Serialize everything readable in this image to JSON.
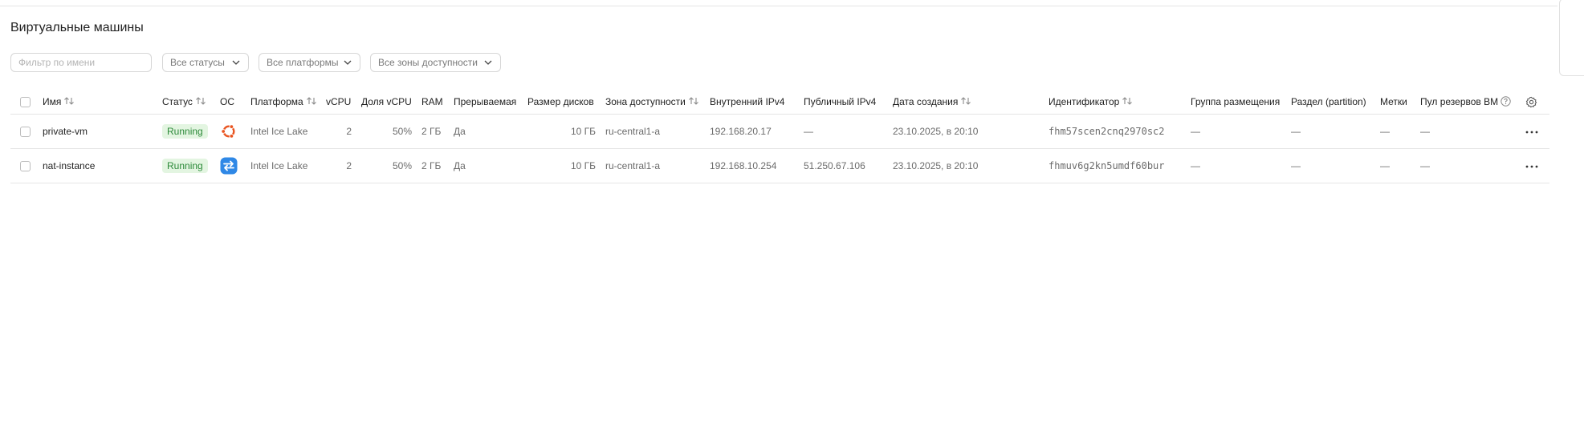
{
  "page": {
    "title": "Виртуальные машины"
  },
  "filters": {
    "name_placeholder": "Фильтр по имени",
    "status": "Все статусы",
    "platform": "Все платформы",
    "zone": "Все зоны доступности"
  },
  "columns": {
    "name": "Имя",
    "status": "Статус",
    "os": "ОС",
    "platform": "Платформа",
    "vcpu": "vCPU",
    "vcpu_share": "Доля vCPU",
    "ram": "RAM",
    "preemptible": "Прерываемая",
    "disk_size": "Размер дисков",
    "zone": "Зона доступности",
    "internal_ipv4": "Внутренний IPv4",
    "public_ipv4": "Публичный IPv4",
    "created": "Дата создания",
    "id": "Идентификатор",
    "placement_group": "Группа размещения",
    "partition": "Раздел (partition)",
    "labels": "Метки",
    "reserve_pool": "Пул резервов ВМ"
  },
  "rows": [
    {
      "name": "private-vm",
      "status": "Running",
      "os_icon": "ubuntu-icon",
      "platform": "Intel Ice Lake",
      "vcpu": "2",
      "vcpu_share": "50%",
      "ram": "2 ГБ",
      "preemptible": "Да",
      "disk_size": "10 ГБ",
      "zone": "ru-central1-a",
      "internal_ipv4": "192.168.20.17",
      "public_ipv4": "—",
      "created": "23.10.2025, в 20:10",
      "id": "fhm57scen2cnq2970sc2",
      "placement_group": "—",
      "partition": "—",
      "labels": "—",
      "reserve_pool": "—"
    },
    {
      "name": "nat-instance",
      "status": "Running",
      "os_icon": "nat-instance-icon",
      "platform": "Intel Ice Lake",
      "vcpu": "2",
      "vcpu_share": "50%",
      "ram": "2 ГБ",
      "preemptible": "Да",
      "disk_size": "10 ГБ",
      "zone": "ru-central1-a",
      "internal_ipv4": "192.168.10.254",
      "public_ipv4": "51.250.67.106",
      "created": "23.10.2025, в 20:10",
      "id": "fhmuv6g2kn5umdf60bur",
      "placement_group": "—",
      "partition": "—",
      "labels": "—",
      "reserve_pool": "—"
    }
  ],
  "colors": {
    "status_bg": "#e3f5e1",
    "status_text": "#2d8a3a",
    "ubuntu": "#e95420",
    "nat": "#2f88e6"
  }
}
